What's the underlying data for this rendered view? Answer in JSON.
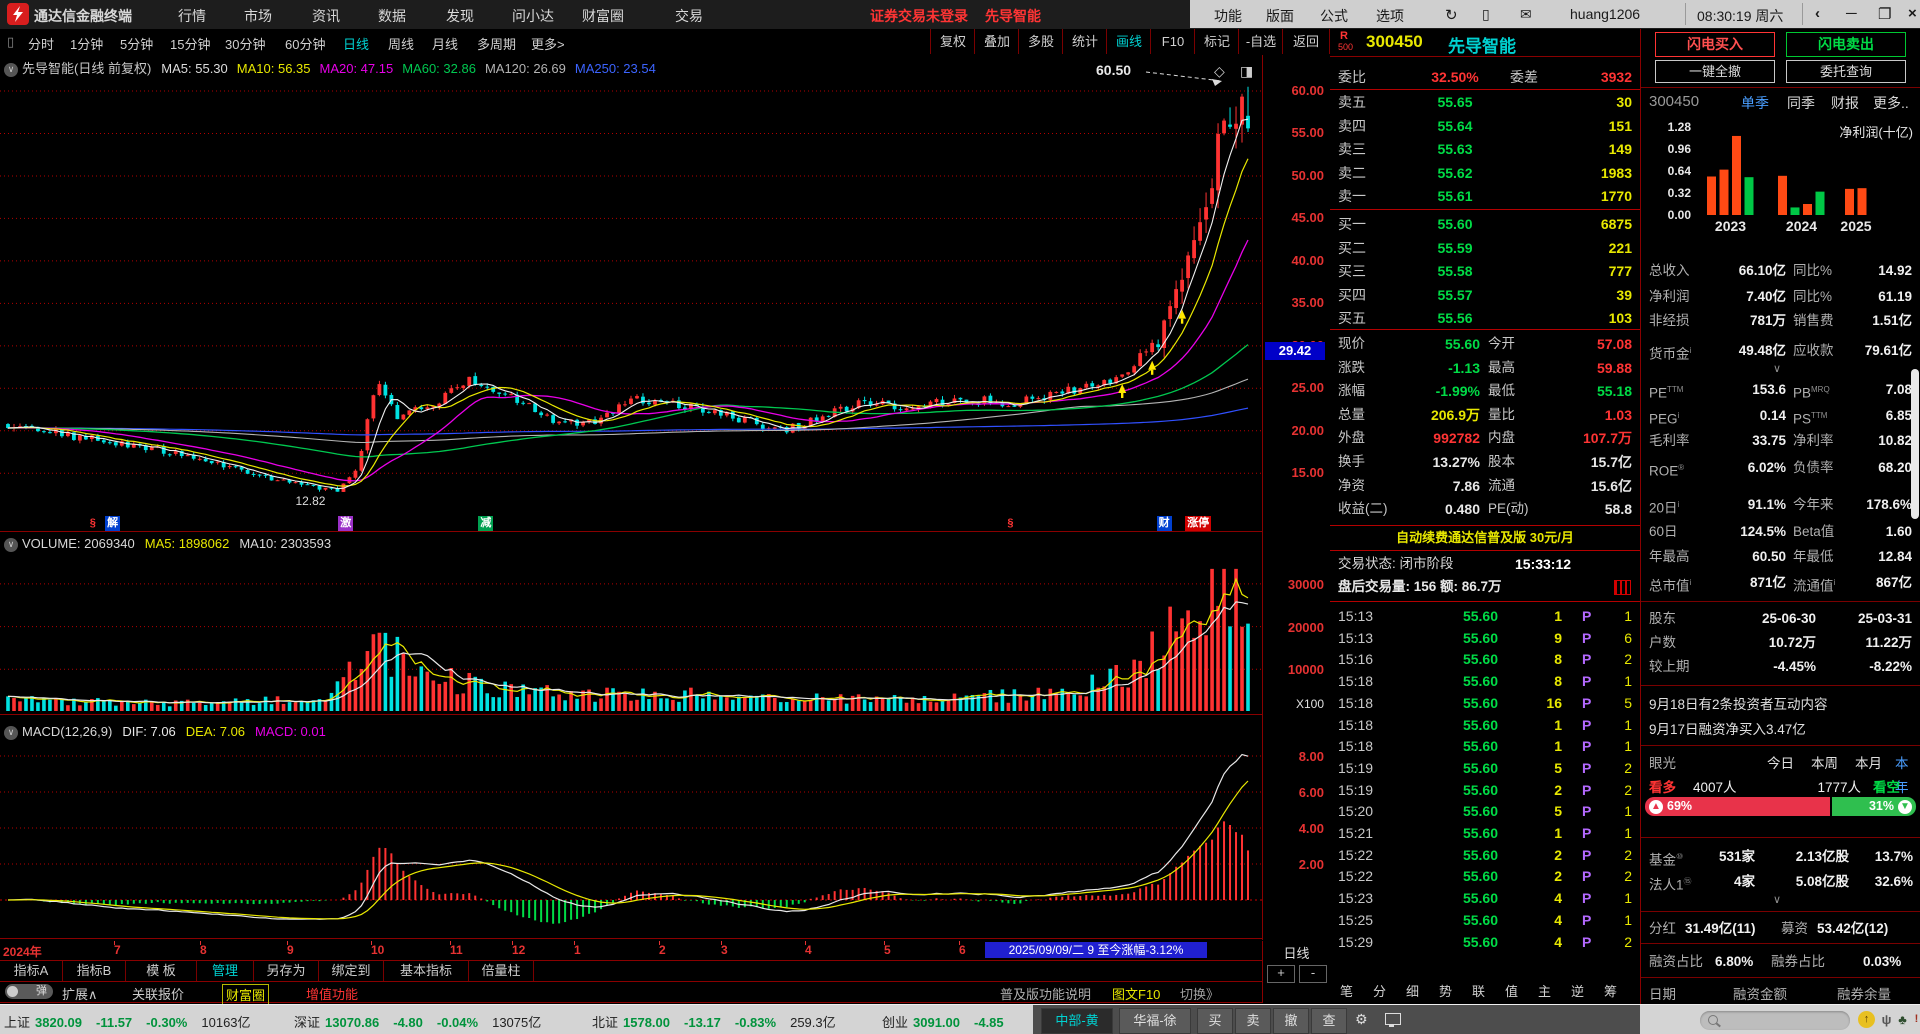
{
  "titlebar": {
    "app_title": "通达信金融终端",
    "menus": [
      "行情",
      "市场",
      "资讯",
      "数据",
      "发现",
      "问小达",
      "财富圈",
      "交易"
    ],
    "alert": "证券交易未登录",
    "alert_stock": "先导智能",
    "right_menus": [
      "功能",
      "版面",
      "公式",
      "选项"
    ],
    "username": "huang1206",
    "clock": "08:30:19 周六",
    "window_controls": [
      "‹",
      "─",
      "❐",
      "×"
    ]
  },
  "toolbar": {
    "periods": [
      {
        "label": "分时"
      },
      {
        "label": "1分钟"
      },
      {
        "label": "5分钟"
      },
      {
        "label": "15分钟"
      },
      {
        "label": "30分钟"
      },
      {
        "label": "60分钟"
      },
      {
        "label": "日线",
        "active": true
      },
      {
        "label": "周线"
      },
      {
        "label": "月线"
      },
      {
        "label": "多周期"
      },
      {
        "label": "更多>"
      }
    ],
    "tools": [
      {
        "label": "复权"
      },
      {
        "label": "叠加"
      },
      {
        "label": "多股"
      },
      {
        "label": "统计"
      },
      {
        "label": "画线",
        "active": true
      },
      {
        "label": "F10"
      },
      {
        "label": "标记"
      },
      {
        "label": "-自选"
      }
    ],
    "back": "返回"
  },
  "chart_header": {
    "title": "先导智能(日线 前复权)",
    "mas": [
      {
        "label": "MA5:",
        "value": "55.30",
        "color": "#dcdcdc"
      },
      {
        "label": "MA10:",
        "value": "56.35",
        "color": "#e8e800"
      },
      {
        "label": "MA20:",
        "value": "47.15",
        "color": "#e800e8"
      },
      {
        "label": "MA60:",
        "value": "32.86",
        "color": "#00c850"
      },
      {
        "label": "MA120:",
        "value": "26.69",
        "color": "#b4b4b4"
      },
      {
        "label": "MA250:",
        "value": "23.54",
        "color": "#3c64ff"
      }
    ]
  },
  "price_axis": {
    "ticks": [
      "60.00",
      "55.00",
      "50.00",
      "45.00",
      "40.00",
      "35.00",
      "30.00",
      "25.00",
      "20.00",
      "15.00"
    ],
    "marker": "29.42",
    "vol_unit": "X100",
    "period": "日线",
    "zoom_in": "+",
    "zoom_out": "-"
  },
  "chart_data": [
    {
      "type": "candlestick",
      "title": "300450 先导智能 日线(前复权)",
      "x_range": [
        "2024-06",
        "2025-09-09"
      ],
      "ylim": [
        7,
        62.5
      ],
      "y_ticks": [
        60,
        55,
        50,
        45,
        40,
        35,
        30,
        25,
        20,
        15
      ],
      "ohlc_today": {
        "open": 57.08,
        "high": 59.88,
        "low": 55.18,
        "close": 55.6,
        "change": -1.13,
        "change_pct": "-1.99%"
      },
      "key_points": {
        "year_high": 60.5,
        "year_low": 12.82,
        "high_label": "60.50",
        "low_label": "12.82",
        "axis_marker": 29.42
      },
      "ma_values": {
        "MA5": 55.3,
        "MA10": 56.35,
        "MA20": 47.15,
        "MA60": 32.86,
        "MA120": 26.69,
        "MA250": 23.54
      },
      "price_anchors": [
        [
          0,
          20.8
        ],
        [
          0.05,
          19.4
        ],
        [
          0.1,
          18.3
        ],
        [
          0.15,
          16.9
        ],
        [
          0.2,
          14.9
        ],
        [
          0.24,
          13.6
        ],
        [
          0.268,
          13.0
        ],
        [
          0.282,
          16.0
        ],
        [
          0.298,
          26.0
        ],
        [
          0.315,
          21.5
        ],
        [
          0.34,
          23.0
        ],
        [
          0.375,
          26.2
        ],
        [
          0.4,
          24.2
        ],
        [
          0.44,
          21.4
        ],
        [
          0.47,
          20.9
        ],
        [
          0.505,
          23.6
        ],
        [
          0.545,
          23.0
        ],
        [
          0.585,
          21.6
        ],
        [
          0.625,
          20.0
        ],
        [
          0.655,
          21.6
        ],
        [
          0.69,
          23.3
        ],
        [
          0.73,
          22.7
        ],
        [
          0.765,
          23.8
        ],
        [
          0.81,
          23.2
        ],
        [
          0.85,
          24.5
        ],
        [
          0.875,
          25.2
        ],
        [
          0.9,
          26.8
        ],
        [
          0.925,
          30.5
        ],
        [
          0.945,
          36.0
        ],
        [
          0.962,
          44.0
        ],
        [
          0.975,
          52.5
        ],
        [
          0.983,
          58.5
        ],
        [
          0.99,
          58.0
        ],
        [
          1,
          56.2
        ]
      ],
      "volume": {
        "label": "VOLUME:",
        "current": "2069340",
        "ma5_label": "MA5:",
        "ma5": "1898062",
        "ma10_label": "MA10:",
        "ma10": "2303593",
        "axis": [
          30000,
          20000,
          10000
        ],
        "unit": "X100",
        "anchors": [
          [
            0,
            2800
          ],
          [
            0.08,
            2300
          ],
          [
            0.15,
            2000
          ],
          [
            0.22,
            2700
          ],
          [
            0.26,
            4200
          ],
          [
            0.285,
            12500
          ],
          [
            0.3,
            16500
          ],
          [
            0.33,
            9000
          ],
          [
            0.37,
            6500
          ],
          [
            0.42,
            5000
          ],
          [
            0.47,
            4000
          ],
          [
            0.52,
            4500
          ],
          [
            0.57,
            3600
          ],
          [
            0.62,
            3000
          ],
          [
            0.67,
            3200
          ],
          [
            0.72,
            2900
          ],
          [
            0.77,
            3400
          ],
          [
            0.82,
            4000
          ],
          [
            0.86,
            5000
          ],
          [
            0.895,
            8500
          ],
          [
            0.92,
            13000
          ],
          [
            0.945,
            20000
          ],
          [
            0.965,
            27000
          ],
          [
            0.978,
            31500
          ],
          [
            0.99,
            26000
          ],
          [
            1,
            20690
          ]
        ]
      },
      "macd": {
        "label": "MACD(12,26,9)",
        "dif_label": "DIF:",
        "dif": "7.06",
        "dea_label": "DEA:",
        "dea": "7.06",
        "macd_label": "MACD:",
        "macd": "0.01",
        "axis": [
          8,
          6,
          4,
          2
        ]
      },
      "events": [
        {
          "t": 0.07,
          "text": "§",
          "style": "mark-red-text"
        },
        {
          "t": 0.084,
          "text": "解",
          "style": "mark-blue"
        },
        {
          "t": 0.272,
          "text": "激",
          "style": "mark-purple"
        },
        {
          "t": 0.385,
          "text": "减",
          "style": "mark-green"
        },
        {
          "t": 0.81,
          "text": "§",
          "style": "mark-red-text"
        },
        {
          "t": 0.932,
          "text": "财",
          "style": "mark-blue"
        },
        {
          "t": 0.955,
          "text": "涨停",
          "style": "mark-red"
        }
      ],
      "buy_arrows_t": [
        0.898,
        0.922,
        0.948
      ]
    },
    {
      "type": "bar",
      "title": "净利润(十亿)",
      "y_ticks": [
        "1.28",
        "0.96",
        "0.64",
        "0.32",
        "0.00"
      ],
      "ylim": [
        0,
        1.28
      ],
      "groups": [
        {
          "year": "2023",
          "bars": [
            {
              "v": 0.56,
              "c": "up"
            },
            {
              "v": 0.66,
              "c": "up"
            },
            {
              "v": 1.15,
              "c": "up"
            },
            {
              "v": 0.55,
              "c": "down"
            }
          ]
        },
        {
          "year": "2024",
          "bars": [
            {
              "v": 0.57,
              "c": "up"
            },
            {
              "v": 0.11,
              "c": "down"
            },
            {
              "v": 0.16,
              "c": "up"
            },
            {
              "v": 0.34,
              "c": "down"
            }
          ]
        },
        {
          "year": "2025",
          "bars": [
            {
              "v": 0.38,
              "c": "up"
            },
            {
              "v": 0.39,
              "c": "up"
            }
          ]
        }
      ]
    }
  ],
  "order_panel": {
    "flag": "R",
    "flag_sub": "500",
    "code": "300450",
    "name": "先导智能",
    "weibi_label": "委比",
    "weibi": "32.50%",
    "weicha_label": "委差",
    "weicha": "3932",
    "asks": [
      [
        "卖五",
        "55.65",
        "30"
      ],
      [
        "卖四",
        "55.64",
        "151"
      ],
      [
        "卖三",
        "55.63",
        "149"
      ],
      [
        "卖二",
        "55.62",
        "1983"
      ],
      [
        "卖一",
        "55.61",
        "1770"
      ]
    ],
    "bids": [
      [
        "买一",
        "55.60",
        "6875"
      ],
      [
        "买二",
        "55.59",
        "221"
      ],
      [
        "买三",
        "55.58",
        "777"
      ],
      [
        "买四",
        "55.57",
        "39"
      ],
      [
        "买五",
        "55.56",
        "103"
      ]
    ],
    "quotes": [
      {
        "l1": "现价",
        "v1": "55.60",
        "c1": "c-grn",
        "l2": "今开",
        "v2": "57.08",
        "c2": "c-red"
      },
      {
        "l1": "涨跌",
        "v1": "-1.13",
        "c1": "c-grn",
        "l2": "最高",
        "v2": "59.88",
        "c2": "c-red"
      },
      {
        "l1": "涨幅",
        "v1": "-1.99%",
        "c1": "c-grn",
        "l2": "最低",
        "v2": "55.18",
        "c2": "c-grn"
      },
      {
        "l1": "总量",
        "v1": "206.9万",
        "c1": "c-yel",
        "l2": "量比",
        "v2": "1.03",
        "c2": "c-red"
      },
      {
        "l1": "外盘",
        "v1": "992782",
        "c1": "c-red",
        "l2": "内盘",
        "v2": "107.7万",
        "c2": "c-red"
      },
      {
        "l1": "换手",
        "v1": "13.27%",
        "c1": "c-wht",
        "l2": "股本",
        "v2": "15.7亿",
        "c2": "c-wht"
      },
      {
        "l1": "净资",
        "v1": "7.86",
        "c1": "c-wht",
        "l2": "流通",
        "v2": "15.6亿",
        "c2": "c-wht"
      },
      {
        "l1": "收益(二)",
        "v1": "0.480",
        "c1": "c-wht",
        "l2": "PE(动)",
        "v2": "58.8",
        "c2": "c-wht"
      }
    ],
    "banner": "自动续费通达信普及版 30元/月",
    "session_label": "交易状态: 闭市阶段",
    "session_time": "15:33:12",
    "after_hours": "盘后交易量: 156 额: 86.7万",
    "tick_flag": "P",
    "ticks": [
      [
        "15:13",
        "55.60",
        "1",
        "1"
      ],
      [
        "15:13",
        "55.60",
        "9",
        "6"
      ],
      [
        "15:16",
        "55.60",
        "8",
        "2"
      ],
      [
        "15:18",
        "55.60",
        "8",
        "1"
      ],
      [
        "15:18",
        "55.60",
        "16",
        "5"
      ],
      [
        "15:18",
        "55.60",
        "1",
        "1"
      ],
      [
        "15:18",
        "55.60",
        "1",
        "1"
      ],
      [
        "15:19",
        "55.60",
        "5",
        "2"
      ],
      [
        "15:19",
        "55.60",
        "2",
        "2"
      ],
      [
        "15:20",
        "55.60",
        "5",
        "1"
      ],
      [
        "15:21",
        "55.60",
        "1",
        "1"
      ],
      [
        "15:22",
        "55.60",
        "2",
        "2"
      ],
      [
        "15:22",
        "55.60",
        "2",
        "2"
      ],
      [
        "15:23",
        "55.60",
        "4",
        "1"
      ],
      [
        "15:25",
        "55.60",
        "4",
        "1"
      ],
      [
        "15:29",
        "55.60",
        "4",
        "2"
      ]
    ],
    "bottom_tabs": [
      "笔",
      "分",
      "细",
      "势",
      "联",
      "值",
      "主",
      "逆",
      "筹"
    ]
  },
  "side_panel": {
    "buy_btn": "闪电买入",
    "sell_btn": "闪电卖出",
    "cancel_btn": "一键全撤",
    "query_btn": "委托查询",
    "code": "300450",
    "views": [
      {
        "label": "单季",
        "active": true
      },
      {
        "label": "同季"
      },
      {
        "label": "财报"
      },
      {
        "label": "更多.."
      }
    ],
    "fin_rows": [
      {
        "l1": "总收入",
        "v1": "66.10亿",
        "l2": "同比%",
        "v2": "14.92"
      },
      {
        "l1": "净利润",
        "v1": "7.40亿",
        "l2": "同比%",
        "v2": "61.19"
      },
      {
        "l1": "非经损",
        "v1": "781万",
        "l2": "销售费",
        "v2": "1.51亿"
      },
      {
        "l1": "货币金",
        "s1": "i",
        "v1": "49.48亿",
        "l2": "应收款",
        "v2": "79.61亿"
      },
      {
        "l1": "PE",
        "s1": "TTM",
        "v1": "153.6",
        "l2": "PB",
        "s2": "MRQ",
        "v2": "7.08"
      },
      {
        "l1": "PEG",
        "s1": "i",
        "v1": "0.14",
        "l2": "PS",
        "s2": "TTM",
        "v2": "6.85"
      },
      {
        "l1": "毛利率",
        "v1": "33.75",
        "l2": "净利率",
        "v2": "10.82"
      },
      {
        "l1": "ROE",
        "s1": "®",
        "v1": "6.02%",
        "l2": "负债率",
        "v2": "68.20"
      },
      {
        "l1": "20日",
        "s1": "i",
        "v1": "91.1%",
        "l2": "今年来",
        "v2": "178.6%"
      },
      {
        "l1": "60日",
        "v1": "124.5%",
        "l2": "Beta值",
        "v2": "1.60"
      },
      {
        "l1": "年最高",
        "v1": "60.50",
        "l2": "年最低",
        "v2": "12.84"
      },
      {
        "l1": "总市值",
        "s1": "i",
        "v1": "871亿",
        "l2": "流通值",
        "s2": "i",
        "v2": "867亿"
      }
    ],
    "holder_rows": [
      {
        "l": "股东",
        "v1": "25-06-30",
        "v2": "25-03-31"
      },
      {
        "l": "户数",
        "v1": "10.72万",
        "v2": "11.22万"
      },
      {
        "l": "较上期",
        "v1": "-4.45%",
        "v2": "-8.22%"
      }
    ],
    "news": [
      "9月18日有2条投资者互动内容",
      "9月17日融资净买入3.47亿"
    ],
    "sentiment": {
      "label": "眼光",
      "tabs": [
        {
          "label": "今日"
        },
        {
          "label": "本周"
        },
        {
          "label": "本月"
        },
        {
          "label": "本年",
          "active": true
        }
      ],
      "bull_label": "看多",
      "bull_count": "4007人",
      "bear_count": "1777人",
      "bear_label": "看空",
      "bull_pct": "69%",
      "bear_pct": "31%",
      "bull_ratio": 0.69
    },
    "inst_rows": [
      {
        "l": "基金",
        "s": "⑩",
        "v1": "531家",
        "v2": "2.13亿股",
        "v3": "13.7%"
      },
      {
        "l": "法人1",
        "s": "⑮",
        "v1": "4家",
        "v2": "5.08亿股",
        "v3": "32.6%"
      }
    ],
    "dividend": {
      "l1": "分红",
      "v1": "31.49亿(11)",
      "l2": "募资",
      "v2": "53.42亿(12)"
    },
    "margin": {
      "l1": "融资占比",
      "v1": "6.80%",
      "l2": "融券占比",
      "v2": "0.03%"
    },
    "table_header": [
      "日期",
      "融资金额",
      "融券余量"
    ]
  },
  "xaxis": {
    "year": "2024年",
    "months": [
      "7",
      "8",
      "9",
      "10",
      "11",
      "12",
      "1",
      "2",
      "3",
      "4",
      "5",
      "6"
    ],
    "date_box": "2025/09/09/二 9 至今涨幅-3.12%"
  },
  "bottom_tabs_row1": [
    {
      "label": "指标A"
    },
    {
      "label": "指标B"
    },
    {
      "label": "模 板"
    },
    {
      "label": "管理",
      "active": true
    },
    {
      "label": "另存为"
    },
    {
      "label": "绑定到"
    },
    {
      "label": "基本指标"
    },
    {
      "label": "倍量柱"
    }
  ],
  "bottom_tabs_row2": {
    "toggle": "弹",
    "items": [
      {
        "label": "扩展∧"
      },
      {
        "label": "关联报价"
      },
      {
        "label": "财富圈",
        "style": "gold"
      },
      {
        "label": "增值功能",
        "style": "red"
      }
    ],
    "right_note": "普及版功能说明",
    "right_link": "图文F10",
    "right_more": "切换》"
  },
  "statusbar": {
    "indices": [
      {
        "name": "上证",
        "value": "3820.09",
        "chg": "-11.57",
        "pct": "-0.30%",
        "amt": "10163亿"
      },
      {
        "name": "深证",
        "value": "13070.86",
        "chg": "-4.80",
        "pct": "-0.04%",
        "amt": "13075亿"
      },
      {
        "name": "北证",
        "value": "1578.00",
        "chg": "-13.17",
        "pct": "-0.83%",
        "amt": "259.3亿"
      },
      {
        "name": "创业",
        "value": "3091.00",
        "chg": "-4.85",
        "pct": "",
        "amt": ""
      }
    ],
    "taskbar": [
      {
        "label": "中部-黄",
        "active": true
      },
      {
        "label": "华福-徐"
      },
      {
        "label": "买"
      },
      {
        "label": "卖"
      },
      {
        "label": "撤"
      },
      {
        "label": "查"
      }
    ]
  }
}
